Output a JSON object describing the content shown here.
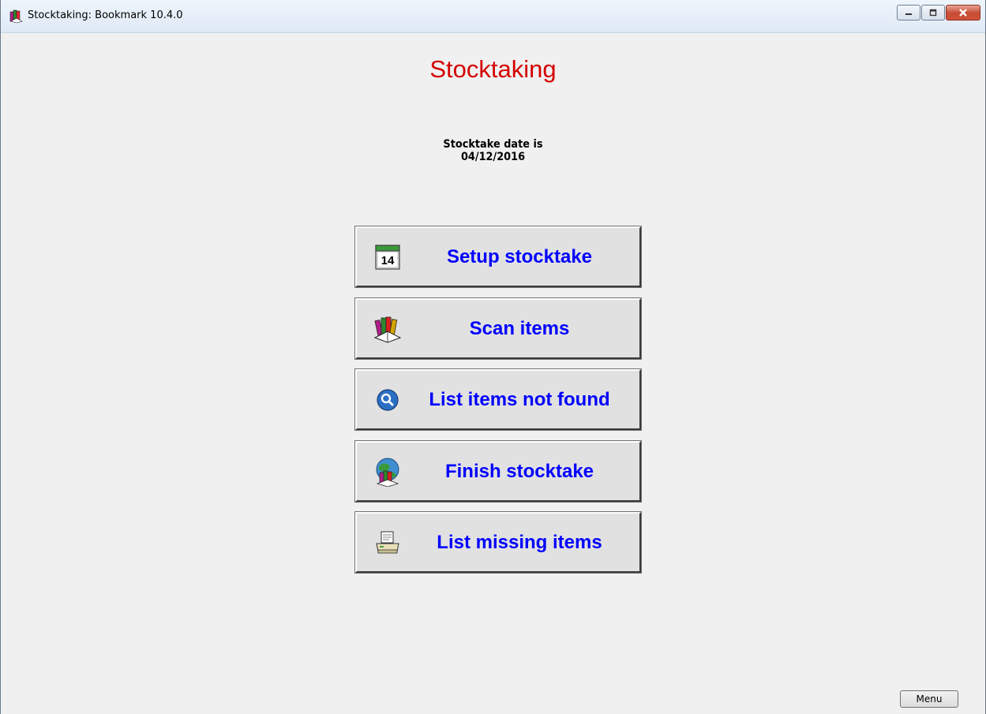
{
  "window": {
    "title": "Stocktaking: Bookmark 10.4.0",
    "app_icon": "books-icon",
    "caption_buttons": [
      "minimize",
      "maximize",
      "close"
    ]
  },
  "main": {
    "heading": "Stocktaking",
    "date_label": "Stocktake date is",
    "date_value": "04/12/2016",
    "buttons": [
      {
        "label": "Setup stocktake",
        "icon": "calendar-icon",
        "icon_text": "14"
      },
      {
        "label": "Scan items",
        "icon": "books-icon"
      },
      {
        "label": "List items not found",
        "icon": "magnifier-icon"
      },
      {
        "label": "Finish stocktake",
        "icon": "globe-books-icon"
      },
      {
        "label": "List missing items",
        "icon": "printer-icon"
      }
    ]
  },
  "footer": {
    "menu_label": "Menu"
  },
  "colors": {
    "heading": "#d40000",
    "button_text": "#0000ff",
    "background": "#f0f0f0"
  }
}
